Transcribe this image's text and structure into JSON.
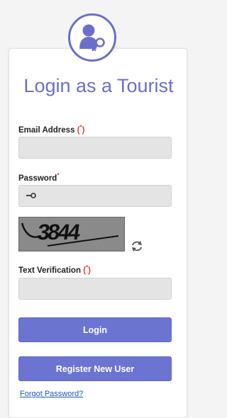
{
  "title": "Login as a Tourist",
  "email": {
    "label": "Email Address",
    "required_mark": "*",
    "value": ""
  },
  "password": {
    "label": "Password",
    "required_mark": "*",
    "icon": "key-icon",
    "value": ""
  },
  "captcha": {
    "text": "3844",
    "refresh_icon": "refresh-icon"
  },
  "verification": {
    "label": "Text Verification",
    "required_mark": "*",
    "value": ""
  },
  "buttons": {
    "login": "Login",
    "register": "Register New User"
  },
  "forgot_link": "Forgot Password?",
  "colors": {
    "accent": "#6b6fc9",
    "button": "#6b75d1",
    "required": "#e23b3b",
    "link": "#1a57c4"
  }
}
